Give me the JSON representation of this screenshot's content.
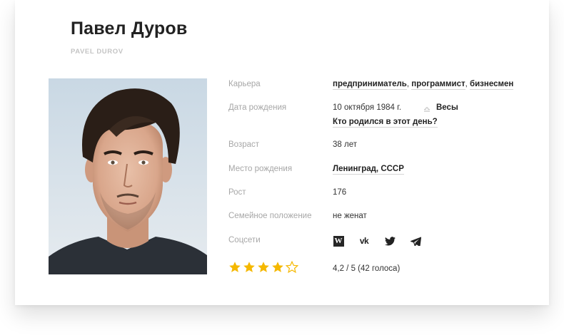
{
  "profile": {
    "name": "Павел Дуров",
    "latin_name": "PAVEL DUROV"
  },
  "facts": {
    "career": {
      "label": "Карьера",
      "items": [
        "предприниматель",
        "программист",
        "бизнесмен"
      ],
      "separator": ", "
    },
    "birth": {
      "label": "Дата рождения",
      "date": "10 октября 1984 г.",
      "zodiac": "Весы",
      "zodiac_icon": "libra-icon",
      "same_day_link": "Кто родился в этот день?"
    },
    "age": {
      "label": "Возраст",
      "value": "38 лет"
    },
    "birthplace": {
      "label": "Место рождения",
      "value": "Ленинград, СССР"
    },
    "height": {
      "label": "Рост",
      "value": "176"
    },
    "marital": {
      "label": "Семейное положение",
      "value": "не женат"
    },
    "socials": {
      "label": "Соцсети",
      "items": [
        {
          "name": "wikipedia",
          "glyph": "W"
        },
        {
          "name": "vk",
          "glyph": "vk"
        },
        {
          "name": "twitter",
          "glyph": ""
        },
        {
          "name": "telegram",
          "glyph": ""
        }
      ]
    }
  },
  "rating": {
    "stars_filled": 4,
    "stars_total": 5,
    "text": "4,2 / 5 (42 голоса)",
    "star_color": "#f5b800"
  }
}
